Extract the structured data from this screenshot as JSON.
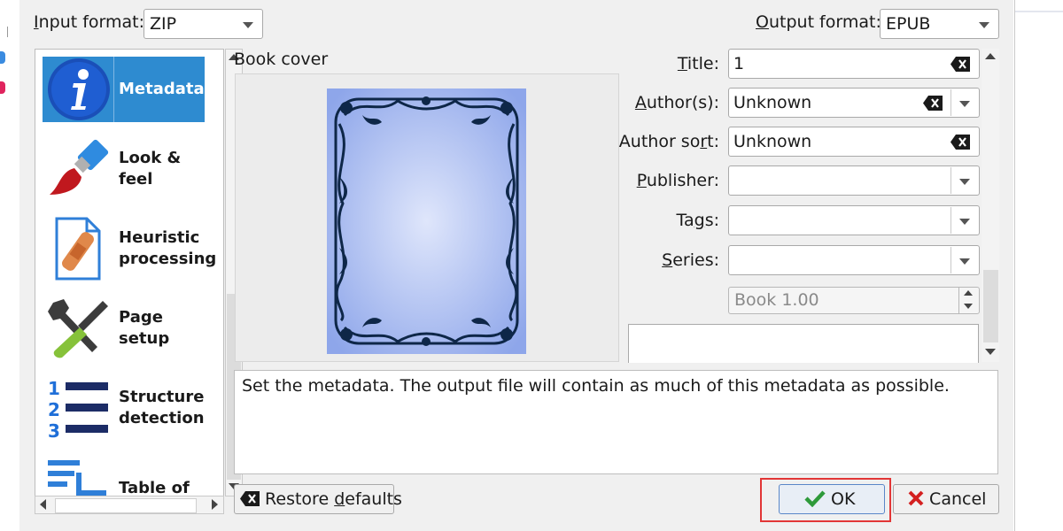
{
  "input_format": {
    "label": "Input format:",
    "value": "ZIP"
  },
  "output_format": {
    "label": "Output format:",
    "value": "EPUB"
  },
  "sidebar": {
    "items": [
      {
        "label": "Metadata",
        "icon": "info-icon",
        "selected": true
      },
      {
        "label": "Look & feel",
        "icon": "paintbrush-icon"
      },
      {
        "label": "Heuristic processing",
        "icon": "bandaid-document-icon"
      },
      {
        "label": "Page setup",
        "icon": "tools-icon"
      },
      {
        "label": "Structure detection",
        "icon": "numbered-list-icon"
      },
      {
        "label": "Table of Contents",
        "icon": "toc-icon"
      }
    ]
  },
  "cover": {
    "label": "Book cover",
    "colors": {
      "background": "#a8b8f0",
      "ornament": "#0e2748"
    }
  },
  "metadata": {
    "title": {
      "label": "Title:",
      "value": "1"
    },
    "authors": {
      "label": "Author(s):",
      "value": "Unknown"
    },
    "author_sort": {
      "label": "Author sort:",
      "value": "Unknown"
    },
    "publisher": {
      "label": "Publisher:",
      "value": ""
    },
    "tags": {
      "label": "Tags:",
      "value": ""
    },
    "series": {
      "label": "Series:",
      "value": ""
    },
    "series_index": {
      "value": "Book 1.00"
    }
  },
  "description": "Set the metadata. The output file will contain as much of this metadata as possible.",
  "buttons": {
    "restore_defaults": "Restore defaults",
    "ok": "OK",
    "cancel": "Cancel"
  },
  "colors": {
    "selection": "#2e8bd0",
    "highlight_border": "#e23636",
    "ok_check": "#2e9a3a",
    "cancel_x": "#d42020"
  }
}
